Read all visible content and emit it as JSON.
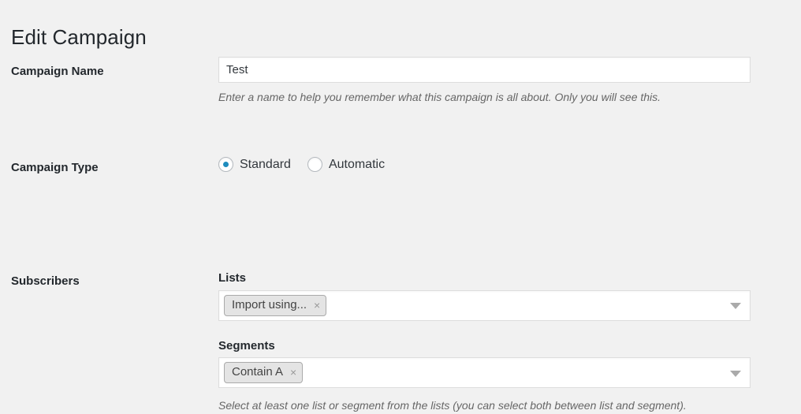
{
  "page": {
    "title": "Edit Campaign"
  },
  "fields": {
    "campaign_name": {
      "label": "Campaign Name",
      "value": "Test",
      "placeholder": "",
      "description": "Enter a name to help you remember what this campaign is all about. Only you will see this."
    },
    "campaign_type": {
      "label": "Campaign Type",
      "options": [
        {
          "label": "Standard",
          "checked": true
        },
        {
          "label": "Automatic",
          "checked": false
        }
      ]
    },
    "subscribers": {
      "label": "Subscribers",
      "lists": {
        "label": "Lists",
        "tokens": [
          {
            "label": "Import using...",
            "remove": "×"
          }
        ],
        "arrow_icon": "chevron-down-icon"
      },
      "segments": {
        "label": "Segments",
        "tokens": [
          {
            "label": "Contain A",
            "remove": "×"
          }
        ],
        "arrow_icon": "chevron-down-icon"
      },
      "description": "Select at least one list or segment from the lists (you can select both between list and segment)."
    }
  },
  "colors": {
    "background": "#f1f1f1",
    "accent": "#1e8cbe",
    "text": "#32373c",
    "muted": "#666666",
    "border": "#dddddd",
    "token_background": "#e4e4e4"
  }
}
